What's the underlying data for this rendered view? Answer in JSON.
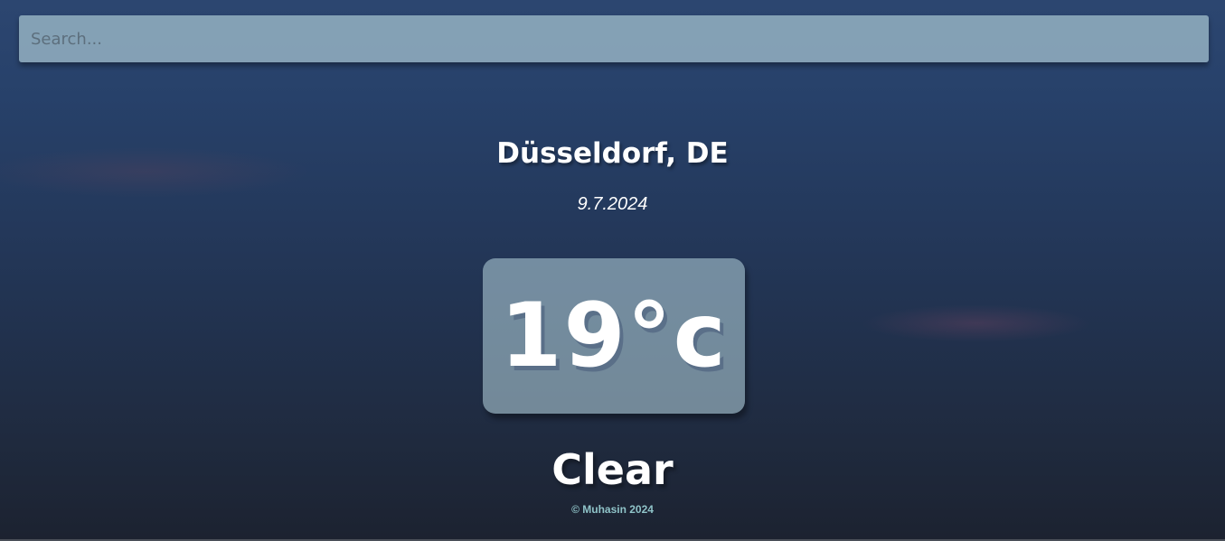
{
  "search": {
    "placeholder": "Search...",
    "value": ""
  },
  "weather": {
    "location": "Düsseldorf, DE",
    "date": "9.7.2024",
    "temperature": "19°c",
    "condition": "Clear"
  },
  "footer": {
    "text": "© Muhasin 2024"
  },
  "colors": {
    "background_top": "#2c4670",
    "background_bottom": "#1c2230",
    "footer_text": "#8fc3c8",
    "text": "#ffffff"
  }
}
